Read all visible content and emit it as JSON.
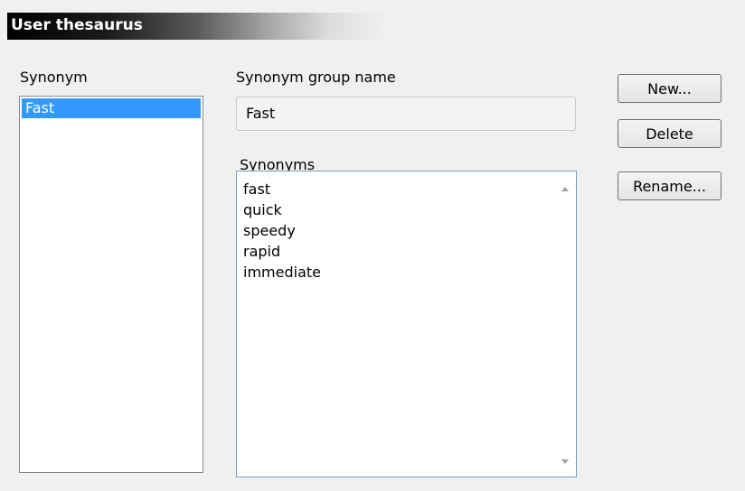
{
  "header": {
    "title": "User thesaurus"
  },
  "synonym_list": {
    "label": "Synonym",
    "items": [
      "Fast"
    ]
  },
  "group_name": {
    "label": "Synonym group name",
    "value": "Fast"
  },
  "synonyms": {
    "label": "Synonyms",
    "items": [
      "fast",
      "quick",
      "speedy",
      "rapid",
      "immediate"
    ]
  },
  "buttons": {
    "new": "New...",
    "delete": "Delete",
    "rename": "Rename..."
  }
}
